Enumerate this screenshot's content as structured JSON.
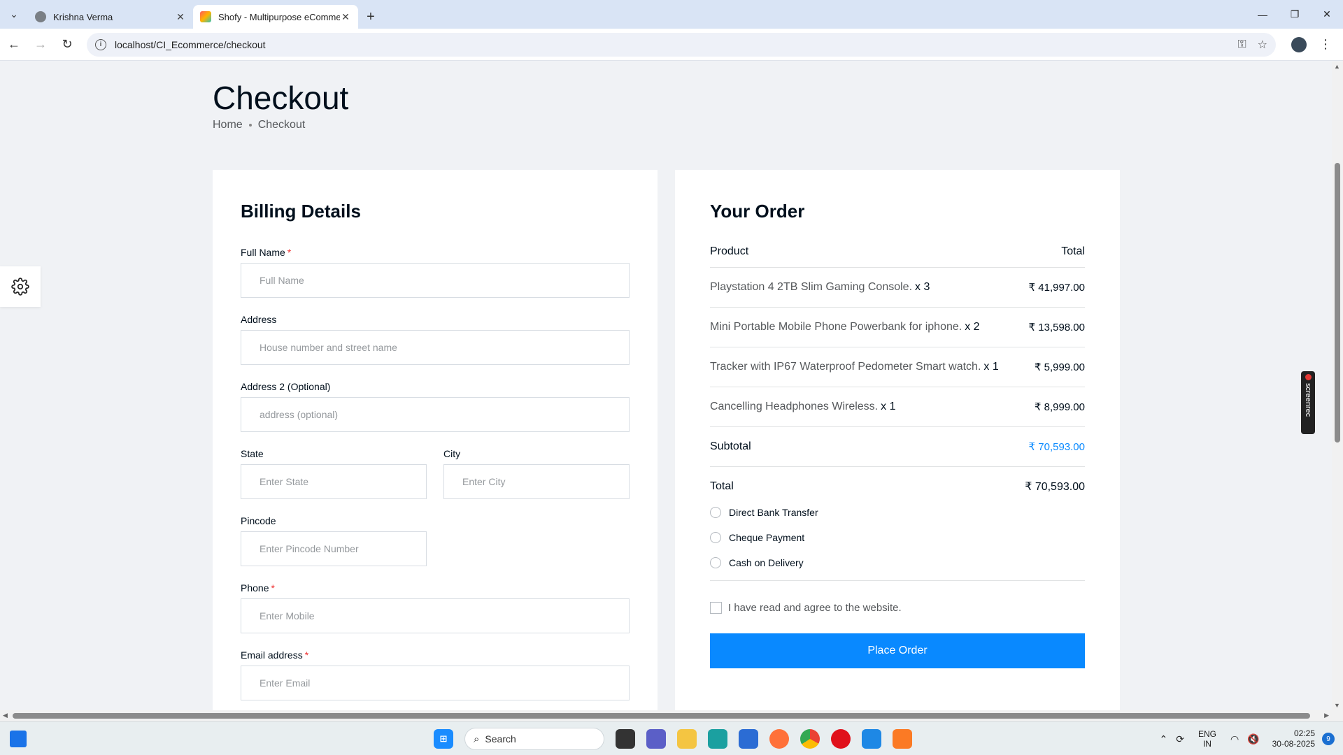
{
  "browser": {
    "tabs": [
      {
        "title": "Krishna Verma",
        "active": false
      },
      {
        "title": "Shofy - Multipurpose eCommerce",
        "active": true
      }
    ],
    "url": "localhost/CI_Ecommerce/checkout"
  },
  "page": {
    "title": "Checkout",
    "breadcrumb": [
      "Home",
      "Checkout"
    ]
  },
  "billing": {
    "heading": "Billing Details",
    "fields": {
      "full_name": {
        "label": "Full Name",
        "placeholder": "Full Name",
        "required": true
      },
      "address": {
        "label": "Address",
        "placeholder": "House number and street name",
        "required": false
      },
      "address2": {
        "label": "Address 2 (Optional)",
        "placeholder": "address (optional)",
        "required": false
      },
      "state": {
        "label": "State",
        "placeholder": "Enter State",
        "required": false
      },
      "city": {
        "label": "City",
        "placeholder": "Enter City",
        "required": false
      },
      "pincode": {
        "label": "Pincode",
        "placeholder": "Enter Pincode Number",
        "required": false
      },
      "phone": {
        "label": "Phone",
        "placeholder": "Enter Mobile",
        "required": true
      },
      "email": {
        "label": "Email address",
        "placeholder": "Enter Email",
        "required": true
      }
    },
    "required_marker": "*"
  },
  "order": {
    "heading": "Your Order",
    "col_product": "Product",
    "col_total": "Total",
    "items": [
      {
        "name": "Playstation 4 2TB Slim Gaming Console.",
        "qty": "x 3",
        "amount": "₹ 41,997.00"
      },
      {
        "name": "Mini Portable Mobile Phone Powerbank for iphone.",
        "qty": "x 2",
        "amount": "₹ 13,598.00"
      },
      {
        "name": "Tracker with IP67 Waterproof Pedometer Smart watch.",
        "qty": "x 1",
        "amount": "₹ 5,999.00"
      },
      {
        "name": "Cancelling Headphones Wireless.",
        "qty": "x 1",
        "amount": "₹ 8,999.00"
      }
    ],
    "subtotal_label": "Subtotal",
    "subtotal": "₹ 70,593.00",
    "total_label": "Total",
    "total": "₹ 70,593.00",
    "payment_options": [
      "Direct Bank Transfer",
      "Cheque Payment",
      "Cash on Delivery"
    ],
    "agree_text": "I have read and agree to the website.",
    "place_order": "Place Order",
    "accent_color": "#0989ff"
  },
  "overlay": {
    "screenrec_label": "screenrec"
  },
  "taskbar": {
    "search_label": "Search",
    "lang_line1": "ENG",
    "lang_line2": "IN",
    "time": "02:25",
    "date": "30-08-2025",
    "notifications": "9"
  }
}
